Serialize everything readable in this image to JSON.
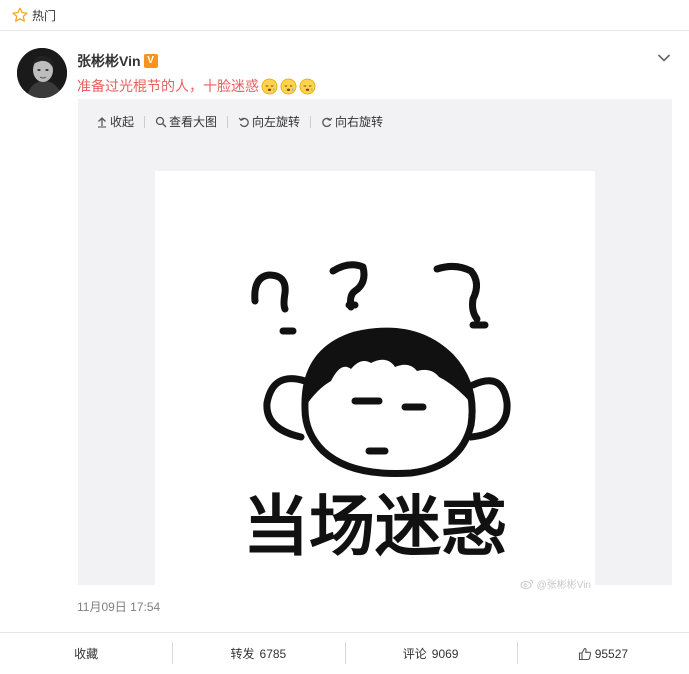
{
  "header": {
    "title": "热门",
    "icon": "star-icon"
  },
  "post": {
    "username": "张彬彬Vin",
    "verified_badge": "V",
    "text": "准备过光棍节的人，十脸迷惑",
    "emojis": [
      "sleepy-face-emoji",
      "sleepy-face-emoji",
      "sleepy-face-emoji"
    ],
    "toolbar": {
      "collapse": "收起",
      "view_large": "查看大图",
      "rotate_left": "向左旋转",
      "rotate_right": "向右旋转"
    },
    "image": {
      "caption": "当场迷惑",
      "watermark": "@张彬彬Vin"
    },
    "timestamp": "11月09日 17:54"
  },
  "actions": {
    "favorite": "收藏",
    "repost_label": "转发",
    "repost_count": "6785",
    "comment_label": "评论",
    "comment_count": "9069",
    "like_count": "95527"
  },
  "colors": {
    "accent_text": "#eb5e5e",
    "badge": "#f7931e",
    "media_bg": "#f2f2f5"
  }
}
